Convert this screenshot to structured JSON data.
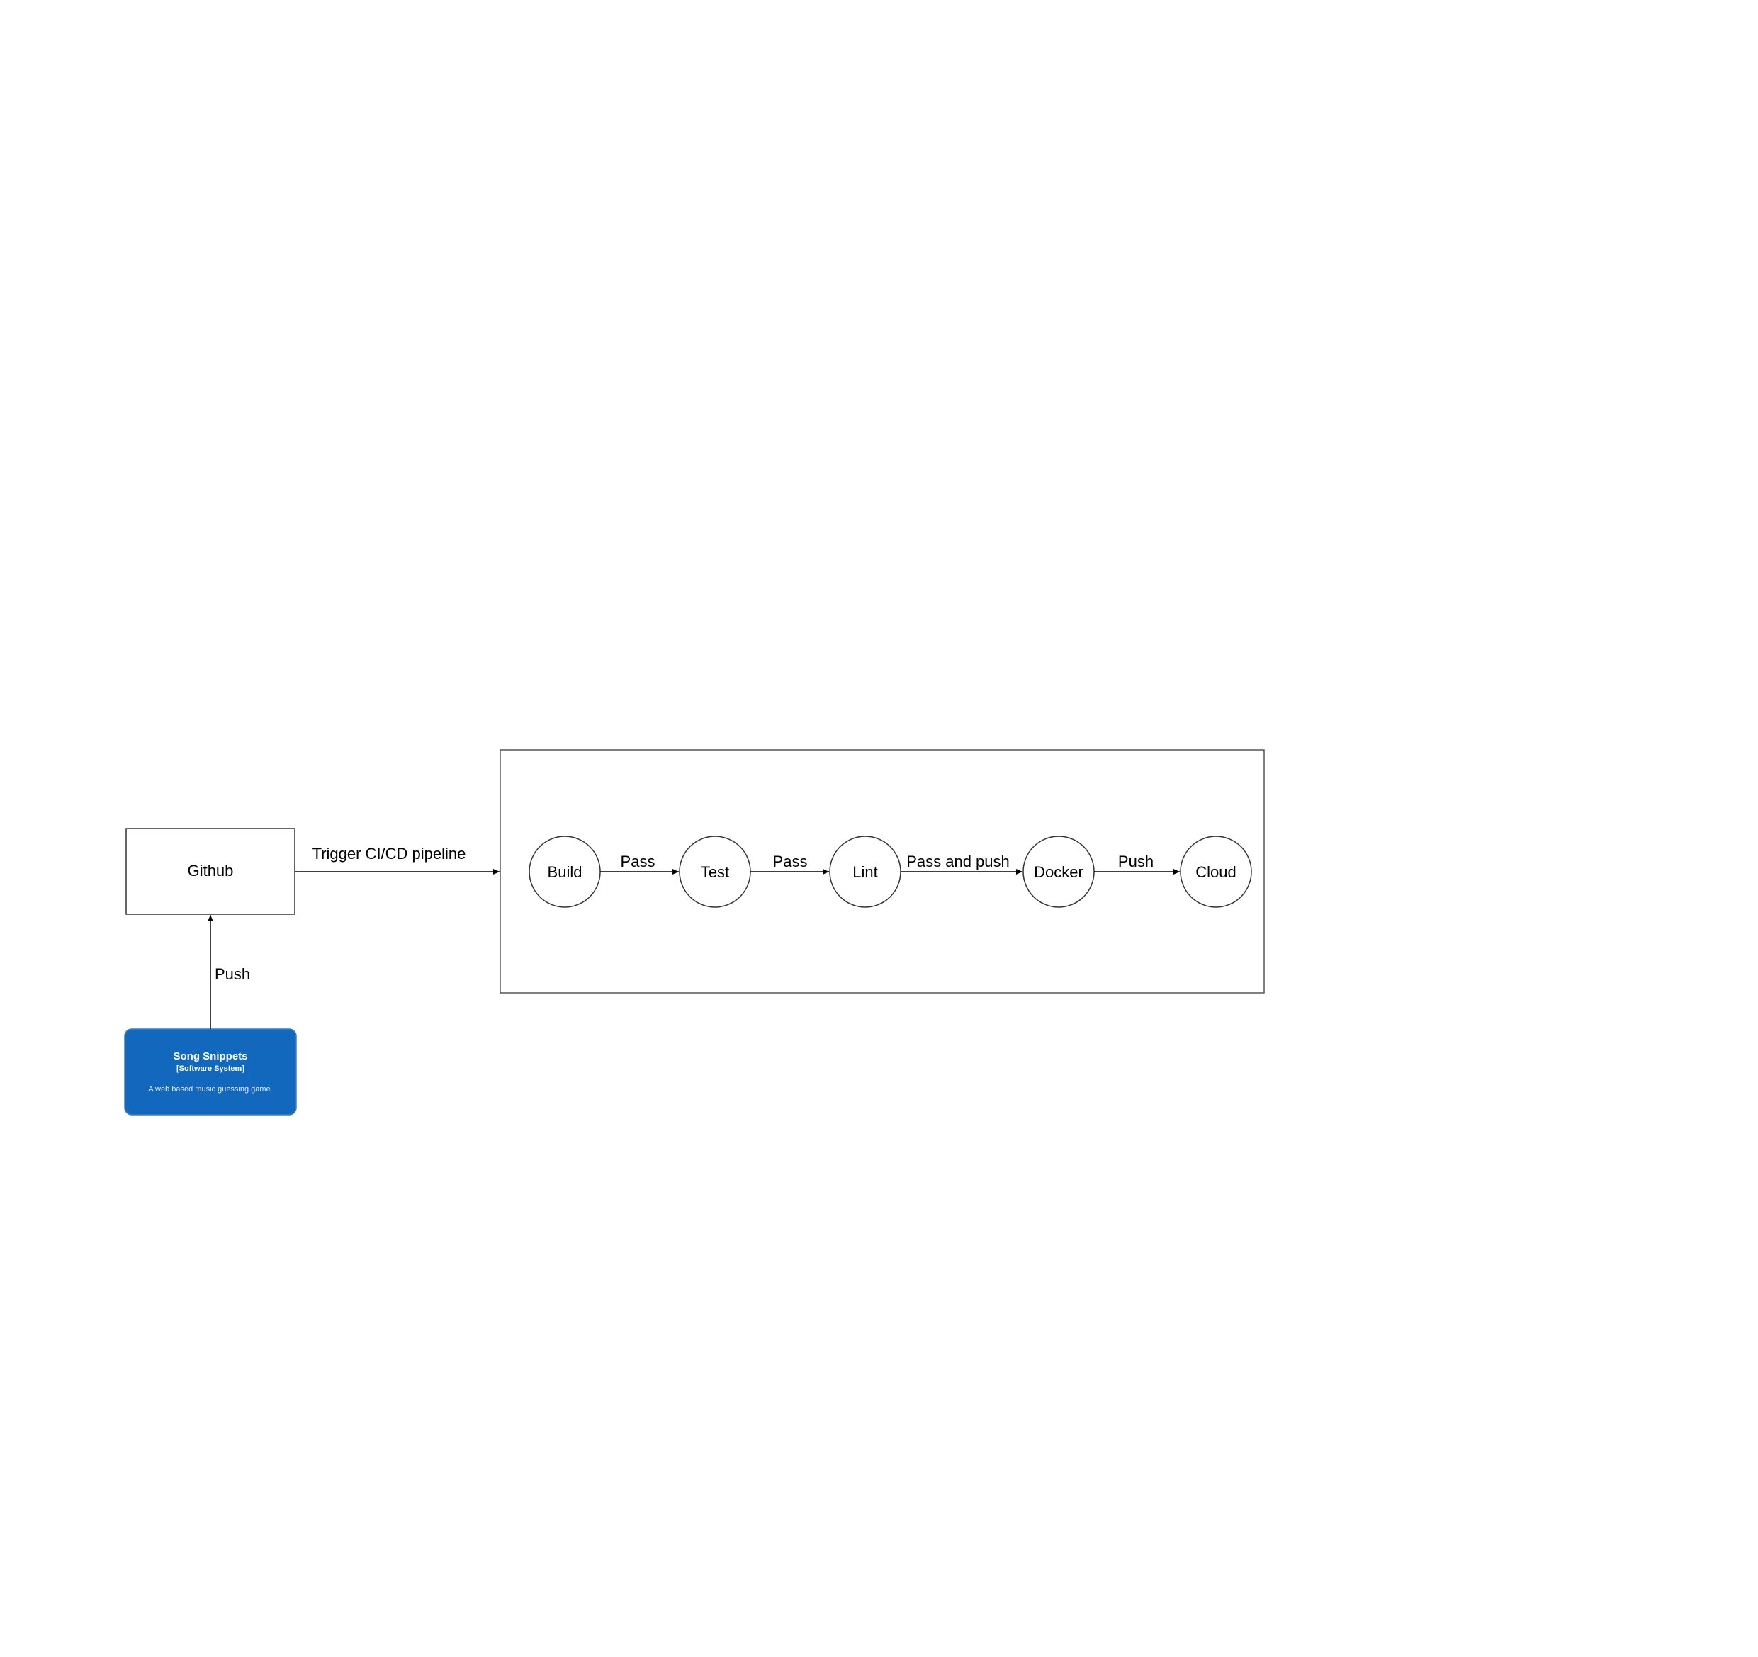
{
  "diagram": {
    "github": {
      "label": "Github"
    },
    "system": {
      "title": "Song Snippets",
      "type": "[Software System]",
      "description": "A web based music guessing game.",
      "fill_color": "#1168BD",
      "border_color": "#3C7FC0"
    },
    "edges": {
      "system_to_github": "Push",
      "github_to_pipeline": "Trigger CI/CD pipeline",
      "build_to_test": "Pass",
      "test_to_lint": "Pass",
      "lint_to_docker": "Pass and push",
      "docker_to_cloud": "Push"
    },
    "stages": [
      {
        "label": "Build"
      },
      {
        "label": "Test"
      },
      {
        "label": "Lint"
      },
      {
        "label": "Docker"
      },
      {
        "label": "Cloud"
      }
    ],
    "line_color": "#000000"
  }
}
